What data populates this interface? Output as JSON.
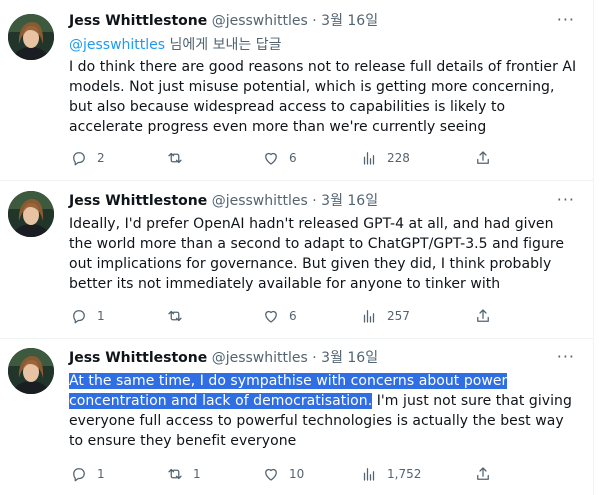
{
  "tweets": [
    {
      "name": "Jess Whittlestone",
      "handle": "@jesswhittles",
      "dot": "·",
      "date": "3월 16일",
      "more": "···",
      "reply_to": {
        "mention": "@jesswhittles",
        "suffix": " 님에게 보내는 답글"
      },
      "text": "I do think there are good reasons not to release full details of frontier AI models. Not just misuse potential, which is getting more concerning, but also because widespread access to capabilities is likely to accelerate progress even more than we're currently seeing",
      "highlighted": "",
      "stats": {
        "replies": "2",
        "retweets": "",
        "likes": "6",
        "views": "228"
      }
    },
    {
      "name": "Jess Whittlestone",
      "handle": "@jesswhittles",
      "dot": "·",
      "date": "3월 16일",
      "more": "···",
      "text": "Ideally, I'd prefer OpenAI hadn't released GPT-4 at all, and had given the world more than a second to adapt to ChatGPT/GPT-3.5 and figure out implications for governance. But given they did, I think probably better its not immediately available for anyone to tinker with",
      "highlighted": "",
      "stats": {
        "replies": "1",
        "retweets": "",
        "likes": "6",
        "views": "257"
      }
    },
    {
      "name": "Jess Whittlestone",
      "handle": "@jesswhittles",
      "dot": "·",
      "date": "3월 16일",
      "more": "···",
      "highlighted": "At the same time, I do sympathise with concerns about power concentration and lack of democratisation.",
      "text": " I'm just not sure that giving everyone full access to powerful technologies is actually the best way to ensure they benefit everyone",
      "stats": {
        "replies": "1",
        "retweets": "1",
        "likes": "10",
        "views": "1,752"
      }
    }
  ],
  "colors": {
    "text_primary": "#0f1419",
    "text_secondary": "#536471",
    "link": "#1d9bf0",
    "selection": "#2f6fe3",
    "divider": "#eff3f4"
  },
  "icons": [
    "reply-icon",
    "retweet-icon",
    "like-icon",
    "views-icon",
    "share-icon",
    "more-icon"
  ]
}
